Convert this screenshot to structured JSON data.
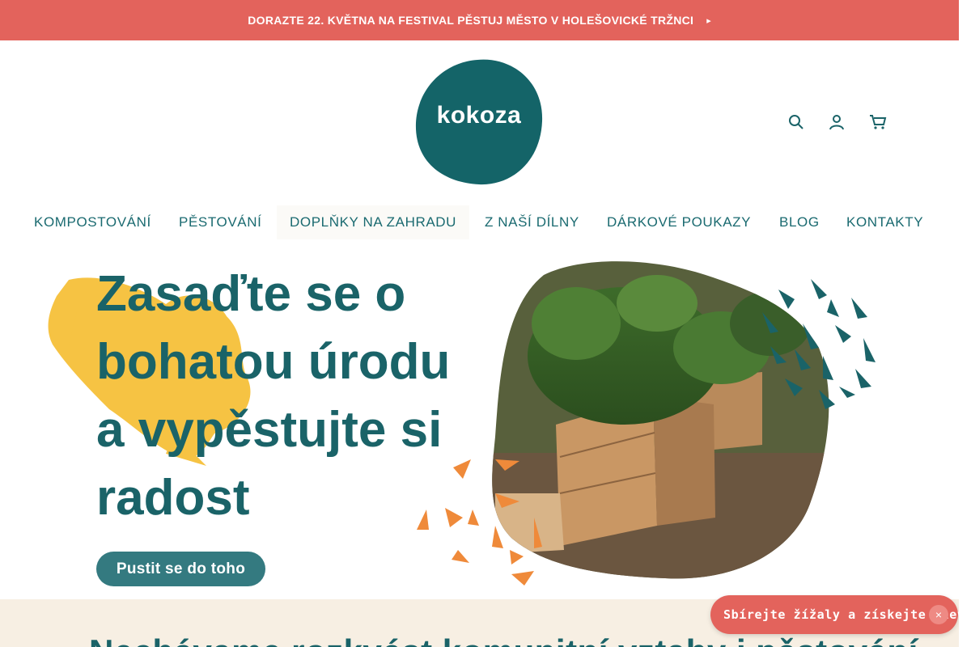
{
  "announcement": {
    "text": "DORAZTE 22. KVĚTNA NA FESTIVAL PĚSTUJ MĚSTO V HOLEŠOVICKÉ TRŽNCI",
    "arrow_icon": "arrow-right-icon"
  },
  "logo": {
    "text": "kokoza"
  },
  "header_icons": [
    "search-icon",
    "user-icon",
    "cart-icon"
  ],
  "nav": {
    "items": [
      {
        "label": "KOMPOSTOVÁNÍ"
      },
      {
        "label": "PĚSTOVÁNÍ"
      },
      {
        "label": "DOPLŇKY NA ZAHRADU"
      },
      {
        "label": "Z NAŠÍ DÍLNY"
      },
      {
        "label": "DÁRKOVÉ POUKAZY"
      },
      {
        "label": "BLOG"
      },
      {
        "label": "KONTAKTY"
      }
    ],
    "active": "DOPLŇKY NA ZAHRADU"
  },
  "hero": {
    "title_lines": [
      "Zasaďte se o",
      "bohatou úrodu",
      "a vypěstujte si",
      "radost"
    ],
    "button_label": "Pustit se do toho"
  },
  "section": {
    "title": "Nechávame rozkvést komunitní vztahy i pěstování"
  },
  "promo": {
    "label": "Sbírejte žížaly a získejte slevy",
    "close_symbol": "×"
  },
  "colors": {
    "brand_teal": "#1a6368",
    "logo_teal": "#146468",
    "coral": "#e3635c",
    "yellow": "#f6c343",
    "orange": "#ef8a3a",
    "cream": "#f7efe3",
    "button": "#347a80"
  }
}
